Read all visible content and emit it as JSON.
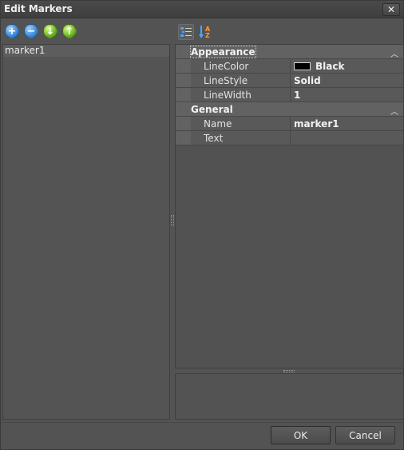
{
  "window": {
    "title": "Edit Markers",
    "close_glyph": "✕"
  },
  "left_toolbar": {
    "buttons": [
      {
        "icon": "add-icon",
        "glyph": "+",
        "color": "blue"
      },
      {
        "icon": "remove-icon",
        "glyph": "−",
        "color": "blue"
      },
      {
        "icon": "move-down-icon",
        "glyph": "↓",
        "color": "green"
      },
      {
        "icon": "move-up-icon",
        "glyph": "↑",
        "color": "green"
      }
    ]
  },
  "right_toolbar": {
    "buttons": [
      {
        "icon": "categorized-view-icon"
      },
      {
        "icon": "alphabetical-sort-icon"
      }
    ]
  },
  "markers_list": {
    "items": [
      "marker1"
    ]
  },
  "property_grid": {
    "categories": [
      {
        "label": "Appearance",
        "properties": [
          {
            "name": "LineColor",
            "value": "Black",
            "swatch_color": "#000000"
          },
          {
            "name": "LineStyle",
            "value": "Solid"
          },
          {
            "name": "LineWidth",
            "value": "1"
          }
        ]
      },
      {
        "label": "General",
        "properties": [
          {
            "name": "Name",
            "value": "marker1"
          },
          {
            "name": "Text",
            "value": ""
          }
        ]
      }
    ]
  },
  "footer": {
    "ok_label": "OK",
    "cancel_label": "Cancel"
  }
}
